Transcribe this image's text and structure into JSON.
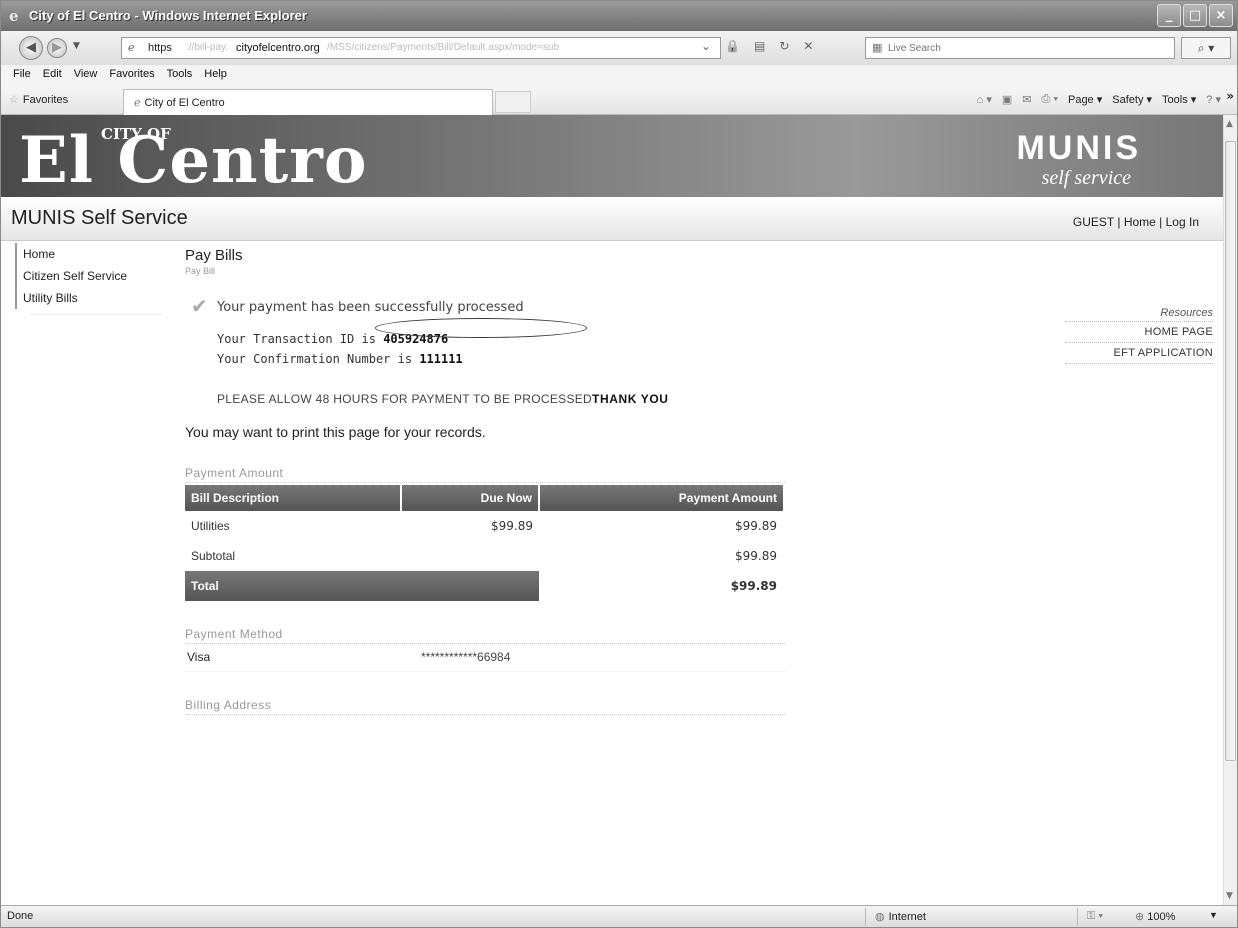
{
  "window": {
    "title": "City of El Centro - Windows Internet Explorer",
    "buttons": {
      "minimize": "_",
      "maximize": "□",
      "close": "×"
    }
  },
  "address": {
    "protocol": "https",
    "dim_prefix": "://bill-pay.",
    "domain": "cityofelcentro.org",
    "path": "/MSS/citizens/Payments/Bill/Default.aspx/mode=sub",
    "search_placeholder": "Live Search"
  },
  "menu": {
    "file": "File",
    "edit": "Edit",
    "view": "View",
    "favorites": "Favorites",
    "tools": "Tools",
    "help": "Help"
  },
  "favbar": {
    "favorites": "Favorites",
    "tab_title": "City of El Centro",
    "page": "Page",
    "safety": "Safety",
    "tools": "Tools",
    "chevron": "»"
  },
  "banner": {
    "logo_main": "El Centro",
    "logo_cityof": "CITY OF",
    "munis": "MUNIS",
    "self_service": "self service",
    "app_name": "MUNIS Self Service",
    "user": "GUEST",
    "home_link": "Home",
    "login_link": "Log In"
  },
  "sidebar": {
    "items": [
      {
        "label": "Home"
      },
      {
        "label": "Citizen Self Service"
      },
      {
        "label": "Utility Bills"
      }
    ]
  },
  "content": {
    "title": "Pay Bills",
    "breadcrumb": "Pay Bill",
    "success_msg": "Your payment has been successfully processed",
    "tx_prefix": "Your Transaction ID is",
    "tx_id": "405924876",
    "conf_prefix": "Your Confirmation Number is",
    "conf_num": "111111",
    "allow": "PLEASE ALLOW 48 HOURS FOR PAYMENT TO BE PROCESSED",
    "thanks": "THANK YOU",
    "may_print": "You may want to print this page for your records.",
    "payment_amount_title": "Payment Amount",
    "table": {
      "headers": {
        "desc": "Bill Description",
        "due": "Due Now",
        "pay": "Payment Amount"
      },
      "rows": [
        {
          "desc": "Utilities",
          "due": "$99.89",
          "pay": "$99.89"
        }
      ],
      "subtotal_label": "Subtotal",
      "subtotal": "$99.89",
      "total_label": "Total",
      "total": "$99.89"
    },
    "payment_method_title": "Payment Method",
    "method": {
      "type": "Visa",
      "number": "************66984"
    },
    "billing_address_title": "Billing Address"
  },
  "resources": {
    "head": "Resources",
    "links": [
      "HOME PAGE",
      "EFT APPLICATION"
    ]
  },
  "status": {
    "text": "Done",
    "zone": "Internet",
    "zoom": "100%"
  }
}
